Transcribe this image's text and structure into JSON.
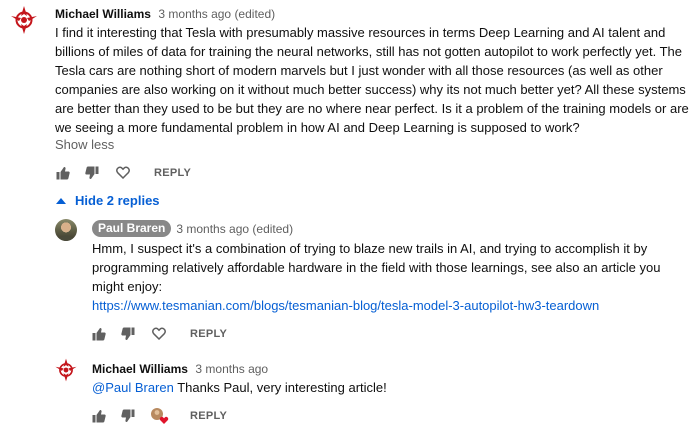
{
  "comments": [
    {
      "author": "Michael Williams",
      "time": "3 months ago (edited)",
      "text": "I find it interesting that Tesla with presumably massive resources in terms Deep Learning and AI talent and billions of miles of data for training the neural networks, still has not gotten autopilot to work perfectly yet. The Tesla cars are nothing short of modern marvels but I just wonder with all those resources (as well as other companies are also working on it without much better success) why its not much better yet? All these systems are better than they used to be but they are no where near perfect. Is it a problem of the training models or are we seeing a more fundamental problem in how AI and Deep Learning is supposed to work?",
      "show_less": "Show less",
      "reply_label": "REPLY",
      "avatar_icon": "klingon-emblem-icon"
    }
  ],
  "replies_toggle": "Hide 2 replies",
  "replies": [
    {
      "author": "Paul Braren",
      "time": "3 months ago (edited)",
      "text": "Hmm, I suspect it's a combination of trying to blaze new trails in AI, and trying to accomplish it by programming relatively affordable hardware in the field with those learnings, see also an article you might enjoy:",
      "link": "https://www.tesmanian.com/blogs/tesmanian-blog/tesla-model-3-autopilot-hw3-teardown",
      "reply_label": "REPLY",
      "avatar_icon": "user-photo"
    },
    {
      "author": "Michael Williams",
      "time": "3 months ago",
      "mention": "@Paul Braren",
      "text": " Thanks Paul, very interesting article!",
      "reply_label": "REPLY",
      "avatar_icon": "klingon-emblem-icon"
    }
  ],
  "colors": {
    "link": "#065fd4",
    "emblem": "#c4161c",
    "heart": "#e0142b",
    "chip": "#888888"
  }
}
